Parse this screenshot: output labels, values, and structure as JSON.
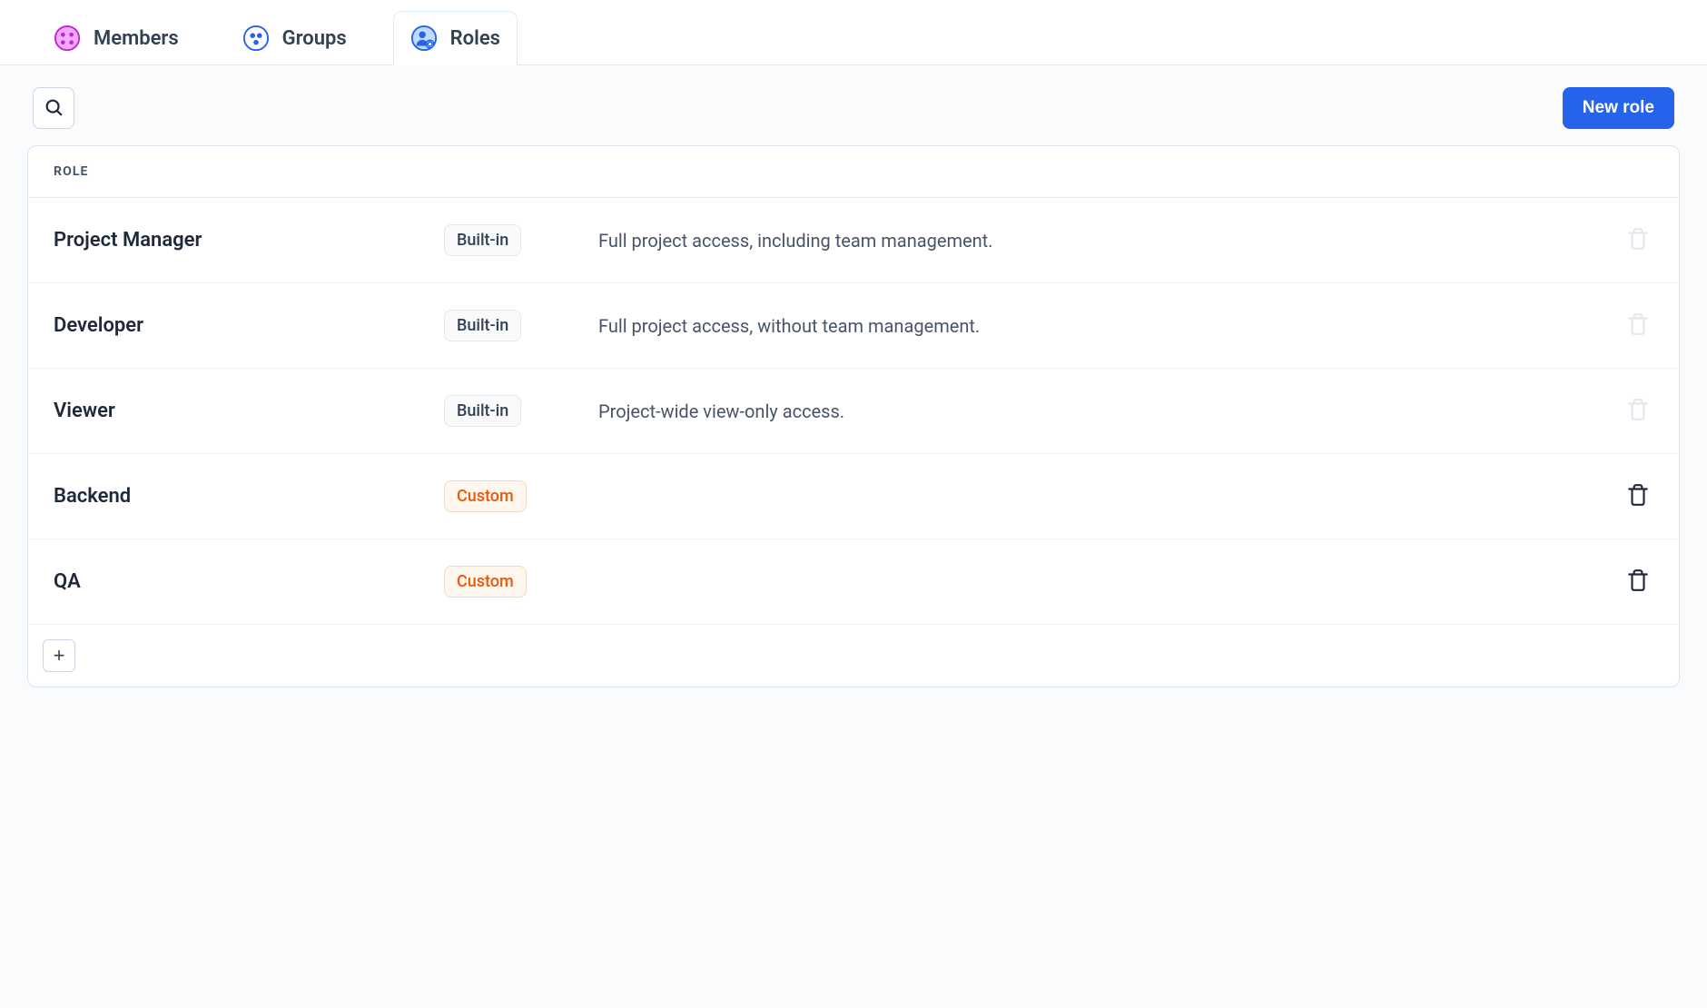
{
  "tabs": [
    {
      "id": "members",
      "label": "Members",
      "active": false,
      "icon": "members-icon",
      "icon_color": "#c026d3",
      "icon_fill": "#f0abfc"
    },
    {
      "id": "groups",
      "label": "Groups",
      "active": false,
      "icon": "groups-icon",
      "icon_color": "#2563eb",
      "icon_fill": "#ffffff"
    },
    {
      "id": "roles",
      "label": "Roles",
      "active": true,
      "icon": "roles-icon",
      "icon_color": "#2563eb",
      "icon_fill": "#93c5fd"
    }
  ],
  "toolbar": {
    "new_role_label": "New role"
  },
  "table": {
    "header": "ROLE",
    "badge_labels": {
      "builtin": "Built-in",
      "custom": "Custom"
    },
    "rows": [
      {
        "name": "Project Manager",
        "type": "builtin",
        "description": "Full project access, including team management.",
        "deletable": false
      },
      {
        "name": "Developer",
        "type": "builtin",
        "description": "Full project access, without team management.",
        "deletable": false
      },
      {
        "name": "Viewer",
        "type": "builtin",
        "description": "Project-wide view-only access.",
        "deletable": false
      },
      {
        "name": "Backend",
        "type": "custom",
        "description": "",
        "deletable": true
      },
      {
        "name": "QA",
        "type": "custom",
        "description": "",
        "deletable": true
      }
    ]
  }
}
